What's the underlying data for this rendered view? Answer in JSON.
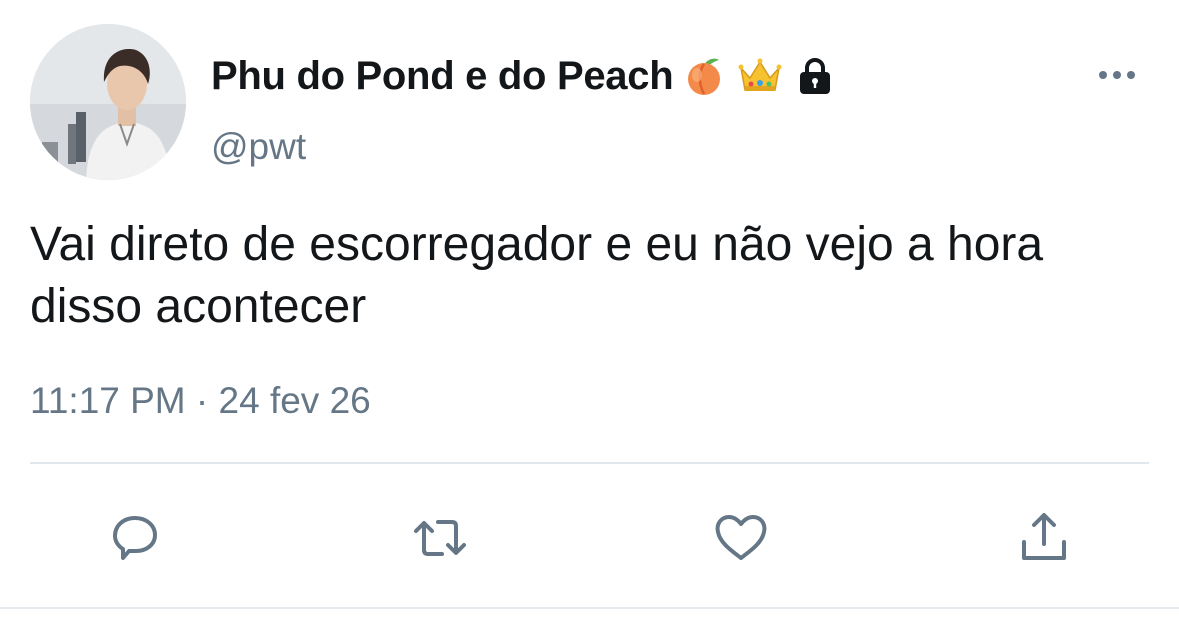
{
  "user": {
    "display_name": "Phu do Pond e do Peach",
    "handle": "@pwt",
    "name_icons": [
      "peach-emoji",
      "crown-emoji",
      "lock-icon"
    ],
    "avatar": "profile-photo"
  },
  "tweet": {
    "text": "Vai direto de escorregador e eu não vejo a hora disso acontecer",
    "time": "11:17 PM",
    "separator": "·",
    "date": "24 fev 26"
  },
  "actions": [
    {
      "icon": "reply-icon"
    },
    {
      "icon": "retweet-icon"
    },
    {
      "icon": "like-icon"
    },
    {
      "icon": "share-icon"
    }
  ],
  "menu": {
    "icon": "more-options-icon"
  },
  "colors": {
    "text": "#14171a",
    "secondary": "#657786",
    "divider": "#e1e8ed",
    "background": "#ffffff"
  }
}
